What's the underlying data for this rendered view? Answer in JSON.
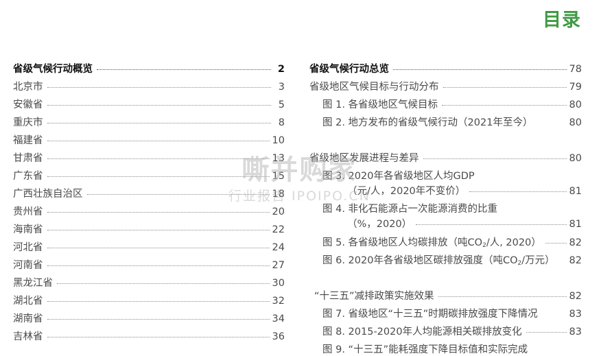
{
  "title": "目录",
  "left": [
    {
      "label": "省级气候行动概览",
      "page": "2",
      "bold": true
    },
    {
      "label": "北京市",
      "page": "3"
    },
    {
      "label": "安徽省",
      "page": "5"
    },
    {
      "label": "重庆市",
      "page": "8"
    },
    {
      "label": "福建省",
      "page": "10"
    },
    {
      "label": "甘肃省",
      "page": "13"
    },
    {
      "label": "广东省",
      "page": "15"
    },
    {
      "label": "广西壮族自治区",
      "page": "18"
    },
    {
      "label": "贵州省",
      "page": "20"
    },
    {
      "label": "海南省",
      "page": "22"
    },
    {
      "label": "河北省",
      "page": "24"
    },
    {
      "label": "河南省",
      "page": "27"
    },
    {
      "label": "黑龙江省",
      "page": "30"
    },
    {
      "label": "湖北省",
      "page": "32"
    },
    {
      "label": "湖南省",
      "page": "34"
    },
    {
      "label": "吉林省",
      "page": "36"
    }
  ],
  "right": {
    "overview": {
      "label": "省级气候行动总览",
      "page": "78"
    },
    "targets_section": {
      "label": "省级地区气候目标与行动分布",
      "page": "79"
    },
    "fig1": {
      "label": "图 1. 各省级地区气候目标",
      "page": "80"
    },
    "fig2": {
      "label": "图 2. 地方发布的省级气候行动（2021年至今）",
      "page": "80"
    },
    "progress_section": {
      "label": "省级地区发展进程与差异",
      "page": "80"
    },
    "fig3_line1": "图 3. 2020年各省级地区人均GDP",
    "fig3_line2": "（元/人，2020年不变价）",
    "fig3_page": "81",
    "fig4_line1": "图 4. 非化石能源占一次能源消费的比重",
    "fig4_line2": "（%，2020）",
    "fig4_page": "81",
    "fig5": {
      "label_pre": "图 5. 各省级地区人均碳排放（吨CO",
      "sub": "2",
      "label_post": "/人, 2020）",
      "page": "82"
    },
    "fig6": {
      "label_pre": "图 6. 2020年各省级地区碳排放强度（吨CO",
      "sub": "2",
      "label_post": "/万元）",
      "page": "82"
    },
    "policy_section": {
      "label": "“十三五”减排政策实施效果",
      "page": "82"
    },
    "fig7": {
      "label": "图 7. 省级地区“十三五”时期碳排放强度下降情况",
      "page": "83"
    },
    "fig8": {
      "label": "图 8. 2015-2020年人均能源相关碳排放变化",
      "page": "83"
    },
    "fig9_partial": "图 9. “十三五”能耗强度下降目标值和实际完成"
  },
  "watermark": {
    "main": "嘶并购家",
    "sub": "行业报告 IPOIPO.CN"
  }
}
